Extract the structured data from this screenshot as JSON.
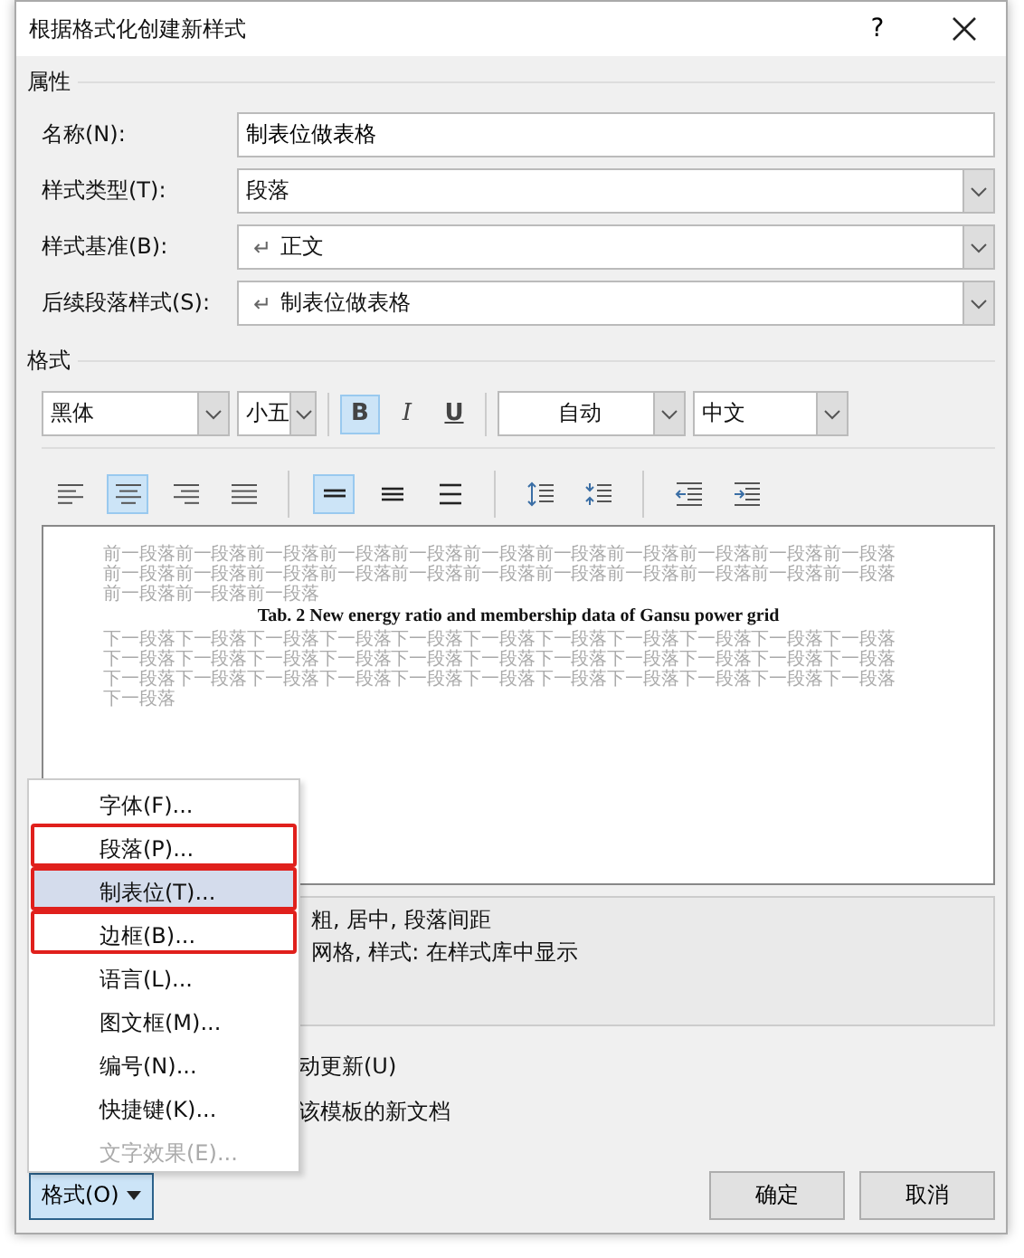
{
  "window": {
    "title": "根据格式化创建新样式",
    "help": "?"
  },
  "properties": {
    "heading": "属性",
    "fields": [
      {
        "label": "名称(N):",
        "value": "制表位做表格",
        "kind": "text"
      },
      {
        "label": "样式类型(T):",
        "value": "段落",
        "kind": "dropdown"
      },
      {
        "label": "样式基准(B):",
        "mark": "↵",
        "value": "正文",
        "kind": "dropdown"
      },
      {
        "label": "后续段落样式(S):",
        "mark": "↵",
        "value": "制表位做表格",
        "kind": "dropdown"
      }
    ]
  },
  "format": {
    "heading": "格式",
    "font": "黑体",
    "size": "小五",
    "toggles": [
      {
        "label": "B",
        "kind": "bold",
        "selected": true
      },
      {
        "label": "I",
        "kind": "italic",
        "selected": false
      },
      {
        "label": "U",
        "kind": "underline",
        "selected": false
      }
    ],
    "font_color_choice": "自动",
    "language": "中文",
    "tools": [
      {
        "kind": "align-left",
        "selected": false
      },
      {
        "kind": "align-center",
        "selected": true
      },
      {
        "kind": "align-right",
        "selected": false
      },
      {
        "kind": "justify",
        "selected": false
      },
      {
        "kind": "sep"
      },
      {
        "kind": "single",
        "selected": true
      },
      {
        "kind": "one-half",
        "selected": false
      },
      {
        "kind": "double",
        "selected": false
      },
      {
        "kind": "sep"
      },
      {
        "kind": "space-more",
        "selected": false
      },
      {
        "kind": "space-less",
        "selected": false
      },
      {
        "kind": "sep"
      },
      {
        "kind": "outdent",
        "selected": false
      },
      {
        "kind": "indent",
        "selected": false
      }
    ]
  },
  "preview": {
    "before": [
      "前一段落前一段落前一段落前一段落前一段落前一段落前一段落前一段落前一段落前一段落前一段落",
      "前一段落前一段落前一段落前一段落前一段落前一段落前一段落前一段落前一段落前一段落前一段落",
      "前一段落前一段落前一段落"
    ],
    "caption": "Tab. 2 New energy ratio and membership data of Gansu power grid",
    "after": [
      "下一段落下一段落下一段落下一段落下一段落下一段落下一段落下一段落下一段落下一段落下一段落",
      "下一段落下一段落下一段落下一段落下一段落下一段落下一段落下一段落下一段落下一段落下一段落",
      "下一段落下一段落下一段落下一段落下一段落下一段落下一段落下一段落下一段落下一段落下一段落",
      "下一段落"
    ]
  },
  "description": [
    "粗, 居中, 段落间距",
    "网格, 样式: 在样式库中显示"
  ],
  "options": [
    "动更新(U)",
    "该模板的新文档"
  ],
  "menu": [
    {
      "label": "字体(F)...",
      "selected": false,
      "disabled": false,
      "annotated": false
    },
    {
      "label": "段落(P)...",
      "selected": false,
      "disabled": false,
      "annotated": true
    },
    {
      "label": "制表位(T)...",
      "selected": true,
      "disabled": false,
      "annotated": true
    },
    {
      "label": "边框(B)...",
      "selected": false,
      "disabled": false,
      "annotated": true
    },
    {
      "label": "语言(L)...",
      "selected": false,
      "disabled": false,
      "annotated": false
    },
    {
      "label": "图文框(M)...",
      "selected": false,
      "disabled": false,
      "annotated": false
    },
    {
      "label": "编号(N)...",
      "selected": false,
      "disabled": false,
      "annotated": false
    },
    {
      "label": "快捷键(K)...",
      "selected": false,
      "disabled": false,
      "annotated": false
    },
    {
      "label": "文字效果(E)...",
      "selected": false,
      "disabled": true,
      "annotated": false
    }
  ],
  "format_button": {
    "label": "格式(O)",
    "pressed": true
  },
  "buttons": [
    "确定",
    "取消"
  ]
}
